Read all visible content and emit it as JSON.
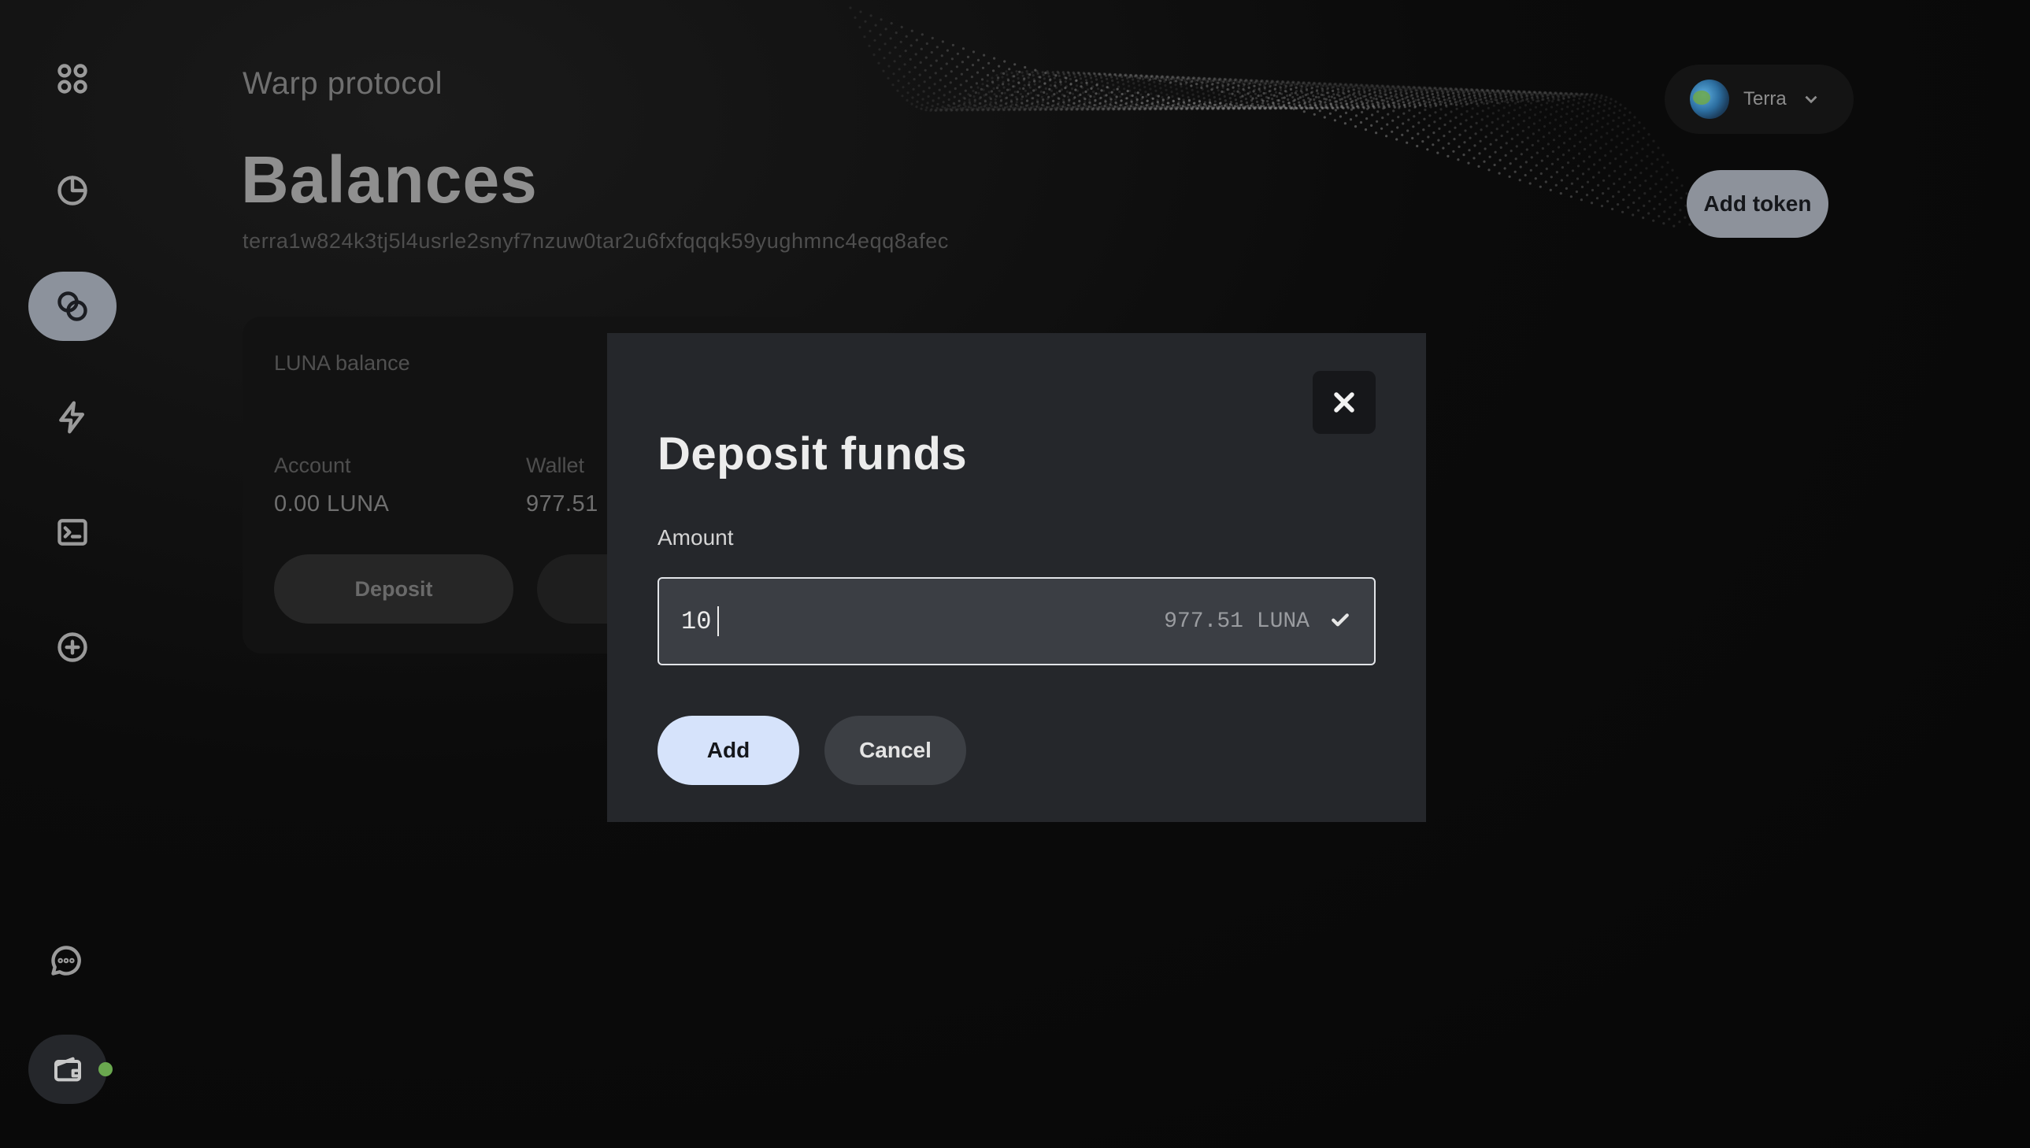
{
  "app": {
    "brand": "Warp protocol",
    "page_title": "Balances",
    "address": "terra1w824k3tj5l4usrle2snyf7nzuw0tar2u6fxfqqqk59yughmnc4eqq8afec"
  },
  "sidebar": {
    "items": [
      {
        "icon": "dashboard-grid-icon",
        "active": false
      },
      {
        "icon": "pie-chart-icon",
        "active": false
      },
      {
        "icon": "balances-coins-icon",
        "active": true
      },
      {
        "icon": "lightning-icon",
        "active": false
      },
      {
        "icon": "terminal-icon",
        "active": false
      },
      {
        "icon": "add-circle-icon",
        "active": false
      }
    ],
    "bottom": [
      {
        "icon": "chat-icon"
      },
      {
        "icon": "wallet-icon",
        "status": "connected",
        "status_color": "#6aa84f"
      }
    ]
  },
  "header": {
    "network_label": "Terra",
    "add_token_label": "Add token"
  },
  "card": {
    "title": "LUNA balance",
    "account_label": "Account",
    "account_value": "0.00 LUNA",
    "wallet_label": "Wallet",
    "wallet_value": "977.51",
    "deposit_label": "Deposit"
  },
  "modal": {
    "title": "Deposit funds",
    "amount_label": "Amount",
    "amount_value": "10",
    "balance_hint": "977.51 LUNA",
    "add_label": "Add",
    "cancel_label": "Cancel"
  },
  "colors": {
    "accent_button": "#d6e3fb",
    "active_nav": "#8c929c",
    "status_connected": "#6aa84f"
  }
}
